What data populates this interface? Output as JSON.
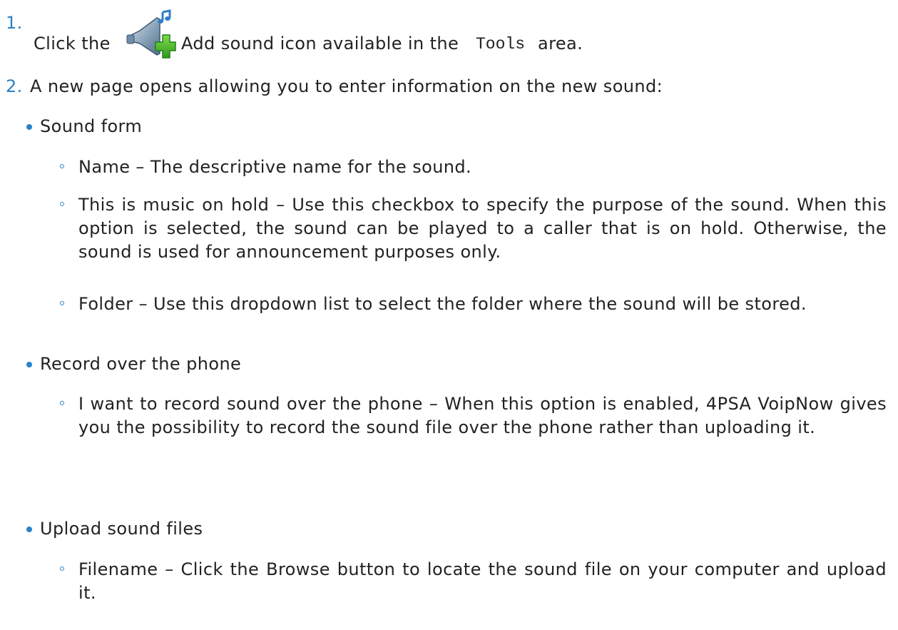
{
  "steps": [
    {
      "number": "1.",
      "text_before": "Click the",
      "icon": "add-sound-icon",
      "text_after": "Add sound icon available in the",
      "code": "Tools",
      "text_end": "area."
    },
    {
      "number": "2.",
      "text": "A new page opens allowing you to enter information on the new sound:"
    }
  ],
  "sections": [
    {
      "title": "Sound form",
      "items": [
        "Name – The descriptive name for the sound.",
        "This is music on hold – Use this checkbox to specify the purpose of the sound. When this option is selected, the sound can be played to a caller that is on hold. Otherwise, the sound is used for announcement purposes only.",
        "Folder – Use this dropdown list to select the folder where the sound will be stored."
      ]
    },
    {
      "title": "Record over the phone",
      "items": [
        "I want to record sound over the phone – When this option is enabled, 4PSA VoipNow gives you the possibility to record the sound file over the phone rather than uploading it."
      ]
    },
    {
      "title": "Upload sound files",
      "items": [
        "Filename – Click the Browse button to locate the sound file on your computer and upload it."
      ]
    }
  ]
}
